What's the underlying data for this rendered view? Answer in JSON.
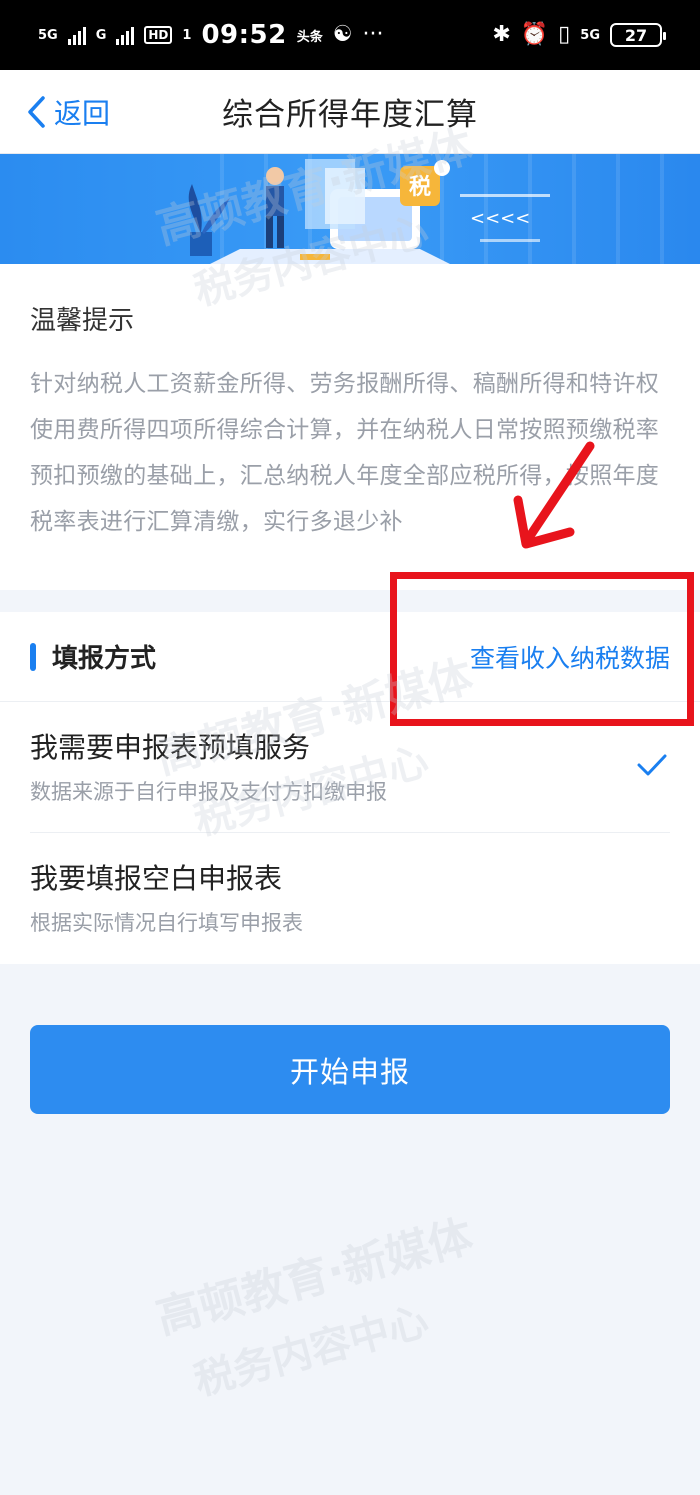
{
  "status_bar": {
    "net1": "5G",
    "net2": "G",
    "hd": "HD",
    "hd_sub": "1",
    "time": "09:52",
    "toutiao": "头条",
    "more": "···",
    "net3": "5G",
    "battery": "27"
  },
  "nav": {
    "back_label": "返回",
    "title": "综合所得年度汇算"
  },
  "banner": {
    "badge": "税",
    "chevrons": "<<<<"
  },
  "tip": {
    "title": "温馨提示",
    "body": "针对纳税人工资薪金所得、劳务报酬所得、稿酬所得和特许权使用费所得四项所得综合计算，并在纳税人日常按照预缴税率预扣预缴的基础上，汇总纳税人年度全部应税所得，按照年度税率表进行汇算清缴，实行多退少补"
  },
  "method": {
    "title": "填报方式",
    "link": "查看收入纳税数据",
    "options": [
      {
        "title": "我需要申报表预填服务",
        "subtitle": "数据来源于自行申报及支付方扣缴申报",
        "selected": true
      },
      {
        "title": "我要填报空白申报表",
        "subtitle": "根据实际情况自行填写申报表",
        "selected": false
      }
    ]
  },
  "start_button": "开始申报",
  "watermark": {
    "line1": "高顿教育·新媒体",
    "line2": "税务内容中心"
  },
  "colors": {
    "accent": "#1a7ff0",
    "button": "#2d8cf0",
    "annotation": "#e8141c"
  }
}
